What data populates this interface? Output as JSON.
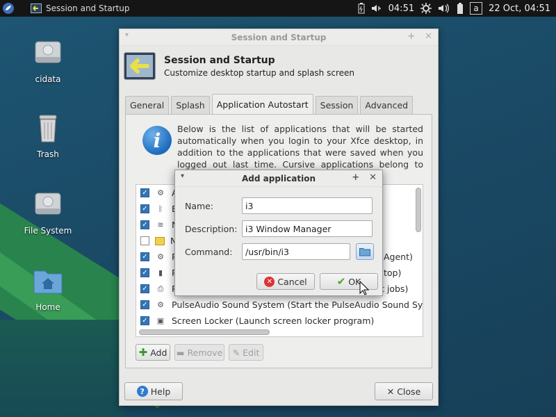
{
  "panel": {
    "task_title": "Session and Startup",
    "clock": "04:51",
    "keyboard_layout": "a",
    "date_time": "22 Oct, 04:51",
    "icons": [
      "xfce-menu-icon",
      "battery-icon",
      "volume-icon",
      "settings-icon",
      "speaker-icon"
    ]
  },
  "desktop": {
    "icons": [
      {
        "label": "cidata",
        "icon": "drive-icon"
      },
      {
        "label": "Trash",
        "icon": "trash-icon"
      },
      {
        "label": "File System",
        "icon": "drive-icon"
      },
      {
        "label": "Home",
        "icon": "home-folder-icon"
      }
    ]
  },
  "window": {
    "title": "Session and Startup",
    "header_title": "Session and Startup",
    "header_subtitle": "Customize desktop startup and splash screen",
    "tabs": [
      "General",
      "Splash",
      "Application Autostart",
      "Session",
      "Advanced"
    ],
    "active_tab": "Application Autostart",
    "info_text": "Below is the list of applications that will be started automatically when you login to your Xfce desktop, in addition to the applications that were saved when you logged out last time. Cursive applications belong to another desktop",
    "list_rows": [
      {
        "checked": true,
        "text": "A",
        "icon": "gear-icon"
      },
      {
        "checked": true,
        "text": "B",
        "icon": "bluetooth-icon"
      },
      {
        "checked": true,
        "text": "N",
        "icon": "wifi-icon"
      },
      {
        "checked": false,
        "text": "N",
        "icon": "note-icon"
      },
      {
        "checked": true,
        "text": "P",
        "tail": "Agent)",
        "icon": "gear-icon"
      },
      {
        "checked": true,
        "text": "P",
        "tail": "top)",
        "icon": "power-icon"
      },
      {
        "checked": true,
        "text": "P",
        "tail": "t jobs)",
        "icon": "printer-icon"
      },
      {
        "checked": true,
        "text": "PulseAudio Sound System (Start the PulseAudio Sound System",
        "icon": "gear-icon"
      },
      {
        "checked": true,
        "text": "Screen Locker (Launch screen locker program)",
        "icon": "monitor-icon"
      }
    ],
    "buttons": {
      "add": "Add",
      "remove": "Remove",
      "edit": "Edit",
      "help": "Help",
      "close": "Close"
    }
  },
  "dialog": {
    "title": "Add application",
    "name_label": "Name:",
    "name_value": "i3",
    "description_label": "Description:",
    "description_value": "i3 Window Manager",
    "command_label": "Command:",
    "command_value": "/usr/bin/i3",
    "cancel": "Cancel",
    "ok": "OK"
  }
}
